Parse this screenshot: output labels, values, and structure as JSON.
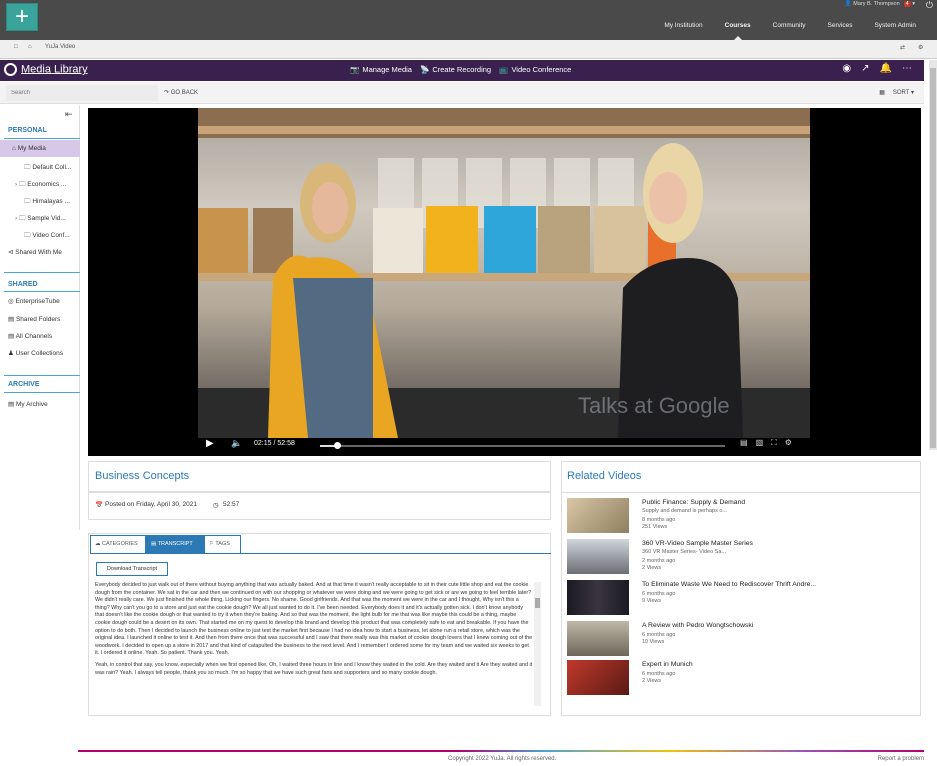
{
  "topbar": {
    "user_name": "Mary B. Thompson",
    "notif_count": "4",
    "nav": [
      "My Institution",
      "Courses",
      "Community",
      "Services",
      "System Admin"
    ],
    "active_nav": "Courses"
  },
  "browser_tab": {
    "title": "YuJa Video"
  },
  "header": {
    "logo": "Media Library",
    "nav": [
      "Manage Media",
      "Create Recording",
      "Video Conference"
    ]
  },
  "toolbar": {
    "search_placeholder": "Search",
    "go_back": "GO BACK",
    "sort": "SORT"
  },
  "sidebar": {
    "personal_heading": "PERSONAL",
    "personal_items": [
      "My Media",
      "Default Coll...",
      "Economics ...",
      "Himalayas ...",
      "Sample Vid...",
      "Video Conf...",
      "Shared With Me"
    ],
    "shared_heading": "SHARED",
    "shared_items": [
      "EnterpriseTube",
      "Shared Folders",
      "All Channels",
      "User Collections"
    ],
    "archive_heading": "ARCHIVE",
    "archive_items": [
      "My Archive"
    ]
  },
  "player": {
    "current_time": "02:15",
    "duration": "52:58",
    "time_text": "02:15 / 52:58",
    "progress": 0.043,
    "watermark": "Talks at Google"
  },
  "video_info": {
    "title": "Business Concepts",
    "posted": "Posted on Friday, April 30, 2021",
    "length": "52:57"
  },
  "tabs": {
    "items": [
      "CATEGORIES",
      "TRANSCRIPT",
      "TAGS"
    ],
    "active": "TRANSCRIPT",
    "download_label": "Download Transcript"
  },
  "transcript": [
    "Everybody decided to just walk out of there without buying anything that was actually baked. And at that time it wasn't really acceptable to sit in their cute little shop and eat the cookie dough from the container. We sat in the car and then we continued on with our shopping or whatever we were doing and we were going to get sick or are we going to feel terrible later? We didn't really care. We just finished the whole thing. Licking our fingers. No shame. Good girlfriends. And that was the moment we were in the car and I thought, Why isn't this a thing? Why can't you go to a store and just eat the cookie dough? We all just wanted to do it. I've been needed. Everybody does it and it's actually gotten sick. I don't know anybody that doesn't like the cookie dough or that wanted to try it when they're baking. And so that was the moment, the light bulb for me that was like maybe this could be a thing, maybe cookie dough could be a desert on its own. That started me on my quest to develop this brand and develop this product that was completely safe to eat and breakable. If you have the option to do both. Then I decided to launch the business online to just test the market first because I had no idea how to start a business, let alone run a retail store, which was the original idea. I launched it online to test it. And then from there once that was successful and I saw that there really was this market of cookie dough lovers that I knew coming out of the woodwork. I decided to open up a store in 2017 and that kind of catapulted the business to the next level. And I remember I ordered some for my team and we waited six weeks to get it. I ordered it online. Yeah. So patient. Thank you. Yeah.",
    "Yeah, in control that say, you know, especially when we first opened like, Oh, I waited three hours in line and I know they waited in the cold. Are they waited and it Are they waited and it was rain? Yeah. I always tell people, thank you so much. I'm so happy that we have such great fans and supporters and so many cookie dough."
  ],
  "related": {
    "title": "Related Videos",
    "items": [
      {
        "title": "Public Finance: Supply & Demand",
        "desc": "Supply and demand is perhaps o...",
        "age": "8 months ago",
        "views": "251 Views"
      },
      {
        "title": "360 VR-Video Sample Master Series",
        "desc": "360 VR Master Series- Video Sa...",
        "age": "2 months ago",
        "views": "2 Views"
      },
      {
        "title": "To Eliminate Waste We Need to Rediscover Thrift Andre...",
        "desc": "",
        "age": "6 months ago",
        "views": "9 Views"
      },
      {
        "title": "A Review with Pedro Wongtschowski",
        "desc": "",
        "age": "6 months ago",
        "views": "10 Views"
      },
      {
        "title": "Expert in Munich",
        "desc": "",
        "age": "6 months ago",
        "views": "2 Views"
      }
    ]
  },
  "footer": {
    "copyright": "Copyright 2022 YuJa. All rights reserved.",
    "report": "Report a problem"
  }
}
